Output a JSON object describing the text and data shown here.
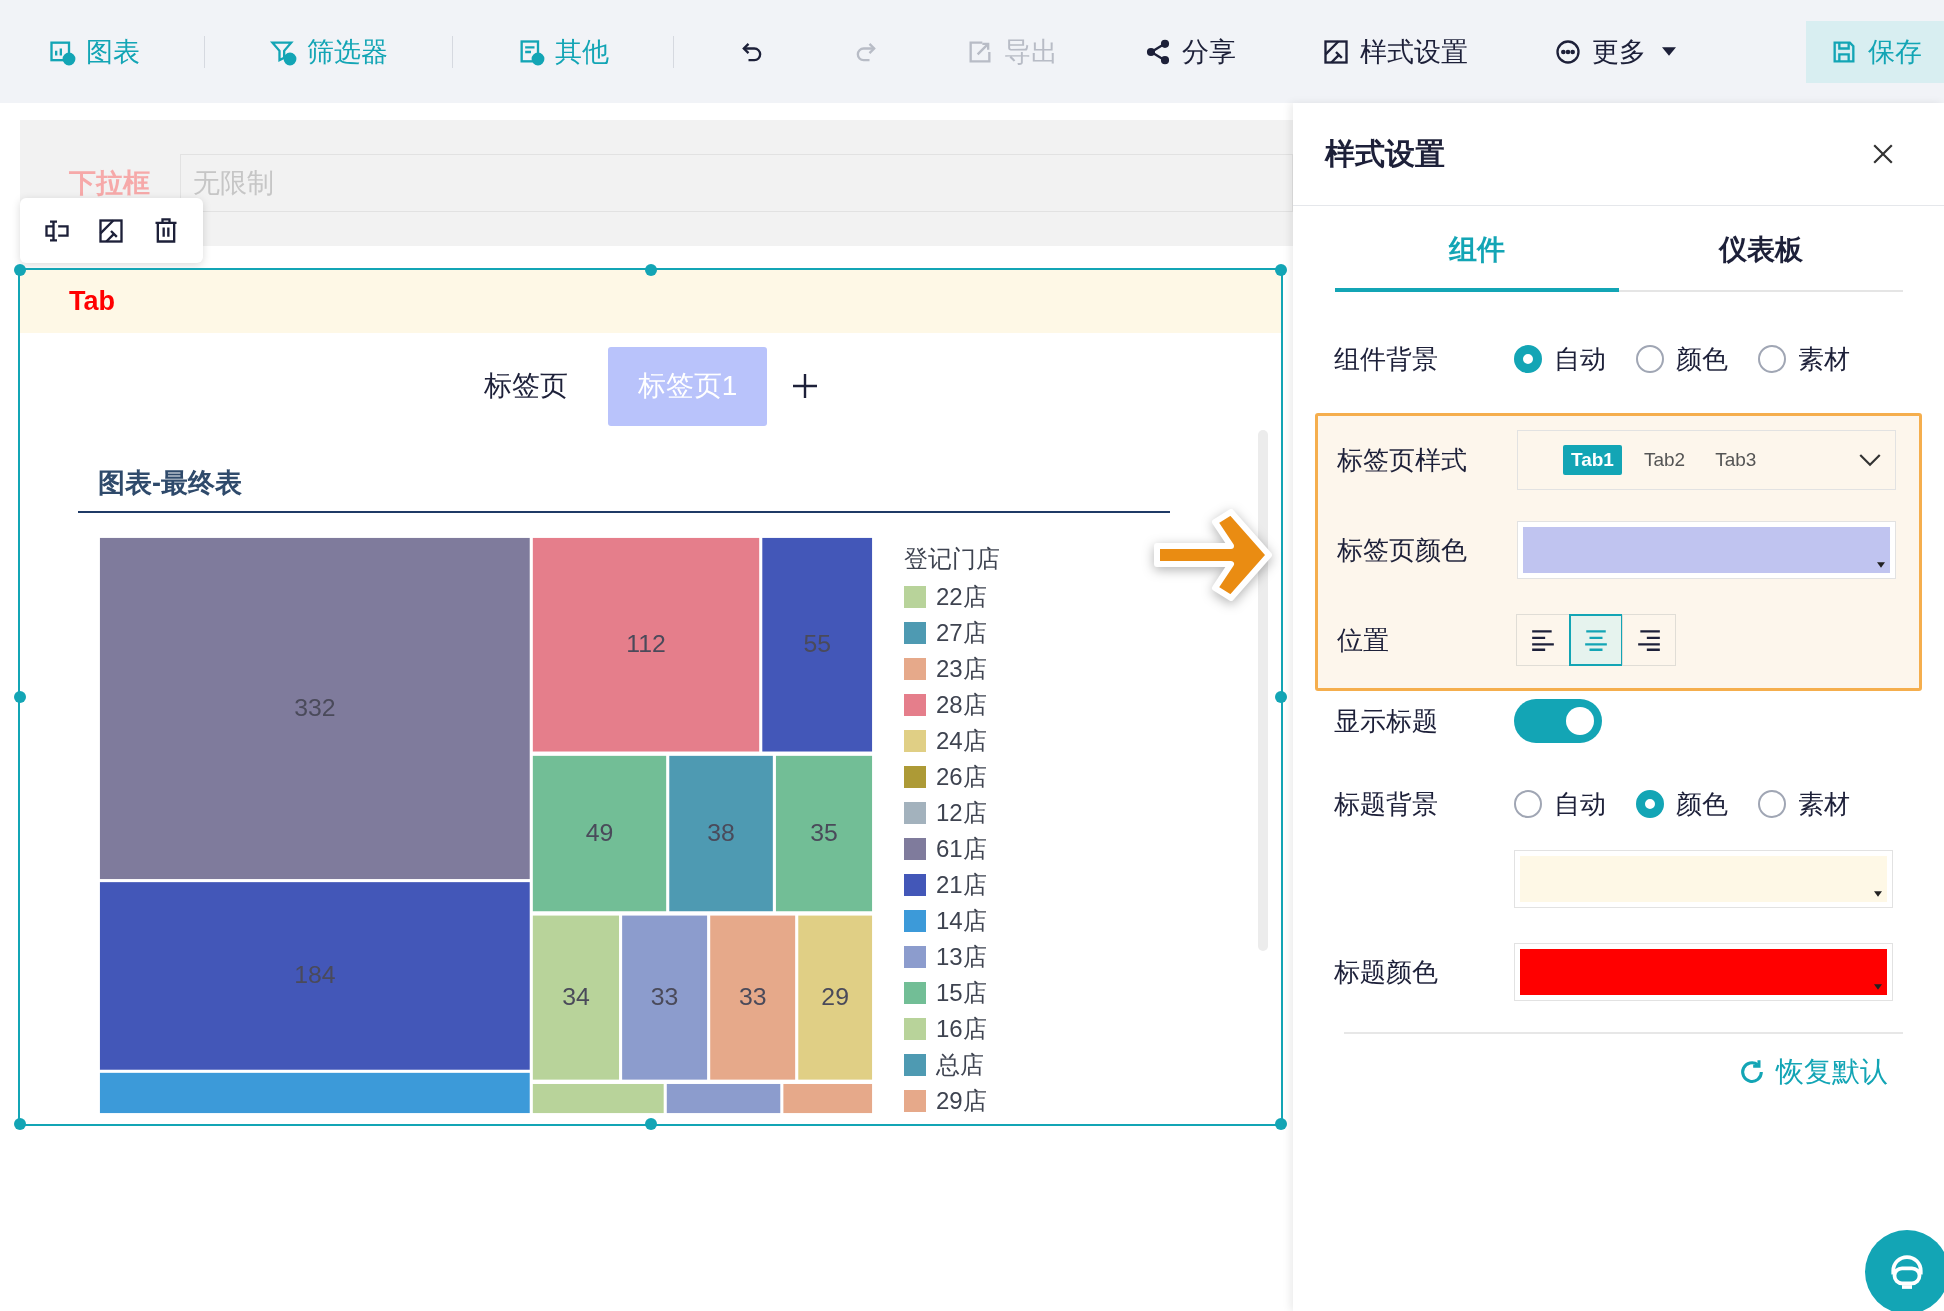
{
  "toolbar": {
    "items": [
      {
        "kind": "chart",
        "label": "图表",
        "disabled": false
      },
      {
        "kind": "filter",
        "label": "筛选器",
        "disabled": false
      },
      {
        "kind": "other",
        "label": "其他",
        "disabled": false
      },
      {
        "kind": "undo",
        "disabled": false
      },
      {
        "kind": "redo",
        "disabled": true
      },
      {
        "kind": "export",
        "label": "导出",
        "disabled": true
      },
      {
        "kind": "share",
        "label": "分享",
        "disabled": false
      },
      {
        "kind": "style",
        "label": "样式设置",
        "disabled": false
      },
      {
        "kind": "more",
        "label": "更多",
        "disabled": false
      },
      {
        "kind": "save",
        "label": "保存",
        "disabled": false
      }
    ]
  },
  "filter_widget": {
    "label": "下拉框",
    "placeholder": "无限制"
  },
  "tab_widget": {
    "title": "Tab",
    "tabs": [
      {
        "label": "标签页",
        "selected": false
      },
      {
        "label": "标签页1",
        "selected": true
      }
    ],
    "chart": {
      "title": "图表-最终表",
      "legend_title": "登记门店",
      "cells": [
        {
          "value": "332",
          "color": "#7f7b9c"
        },
        {
          "value": "184",
          "color": "#4357b8"
        },
        {
          "color": "#3c9ad9"
        },
        {
          "value": "112",
          "color": "#e57e8b"
        },
        {
          "value": "55",
          "color": "#4357b8"
        },
        {
          "value": "49",
          "color": "#72be96"
        },
        {
          "value": "38",
          "color": "#4e9ab2"
        },
        {
          "value": "35",
          "color": "#72be96"
        },
        {
          "value": "34",
          "color": "#b8d39a"
        },
        {
          "value": "33",
          "color": "#8c9ccd"
        },
        {
          "value": "33",
          "color": "#e6a98a"
        },
        {
          "value": "29",
          "color": "#e0cf85"
        },
        {
          "color": "#b8d39a"
        },
        {
          "color": "#8c9ccd"
        },
        {
          "color": "#e6a98a"
        }
      ],
      "legend": [
        {
          "label": "22店",
          "color": "#b8d39a"
        },
        {
          "label": "27店",
          "color": "#4e9ab2"
        },
        {
          "label": "23店",
          "color": "#e6a98a"
        },
        {
          "label": "28店",
          "color": "#e57e8b"
        },
        {
          "label": "24店",
          "color": "#e0cf85"
        },
        {
          "label": "26店",
          "color": "#ad9a36"
        },
        {
          "label": "12店",
          "color": "#a3b2bd"
        },
        {
          "label": "61店",
          "color": "#7f7b9c"
        },
        {
          "label": "21店",
          "color": "#4357b8"
        },
        {
          "label": "14店",
          "color": "#3c9ad9"
        },
        {
          "label": "13店",
          "color": "#8c9ccd"
        },
        {
          "label": "15店",
          "color": "#72be96"
        },
        {
          "label": "16店",
          "color": "#b8d39a"
        },
        {
          "label": "总店",
          "color": "#4e9ab2"
        },
        {
          "label": "29店",
          "color": "#e6a98a"
        }
      ]
    }
  },
  "panel": {
    "title": "样式设置",
    "tabs": [
      {
        "label": "组件",
        "selected": true
      },
      {
        "label": "仪表板",
        "selected": false
      }
    ],
    "sections": [
      {
        "highlighted": false,
        "rows": [
          {
            "kind": "radio",
            "label": "组件背景",
            "options": [
              {
                "label": "自动",
                "selected": true
              },
              {
                "label": "颜色",
                "selected": false
              },
              {
                "label": "素材",
                "selected": false
              }
            ]
          }
        ]
      },
      {
        "highlighted": true,
        "rows": [
          {
            "kind": "tabstyle",
            "label": "标签页样式",
            "options": [
              {
                "label": "Tab1",
                "selected": true
              },
              {
                "label": "Tab2",
                "selected": false
              },
              {
                "label": "Tab3",
                "selected": false
              }
            ]
          },
          {
            "kind": "color",
            "label": "标签页颜色",
            "color": "#c0c4f0"
          },
          {
            "kind": "align",
            "label": "位置",
            "options": [
              {
                "selected": false
              },
              {
                "selected": true
              },
              {
                "selected": false
              }
            ]
          }
        ]
      },
      {
        "highlighted": false,
        "rows": [
          {
            "kind": "toggle",
            "label": "显示标题",
            "on": true
          },
          {
            "kind": "radio",
            "label": "标题背景",
            "options": [
              {
                "label": "自动",
                "selected": false
              },
              {
                "label": "颜色",
                "selected": true
              },
              {
                "label": "素材",
                "selected": false
              }
            ]
          },
          {
            "kind": "color",
            "color": "#fef8e6"
          },
          {
            "kind": "color",
            "label": "标题颜色",
            "color": "#ff0000"
          }
        ]
      }
    ],
    "reset": "恢复默认"
  }
}
